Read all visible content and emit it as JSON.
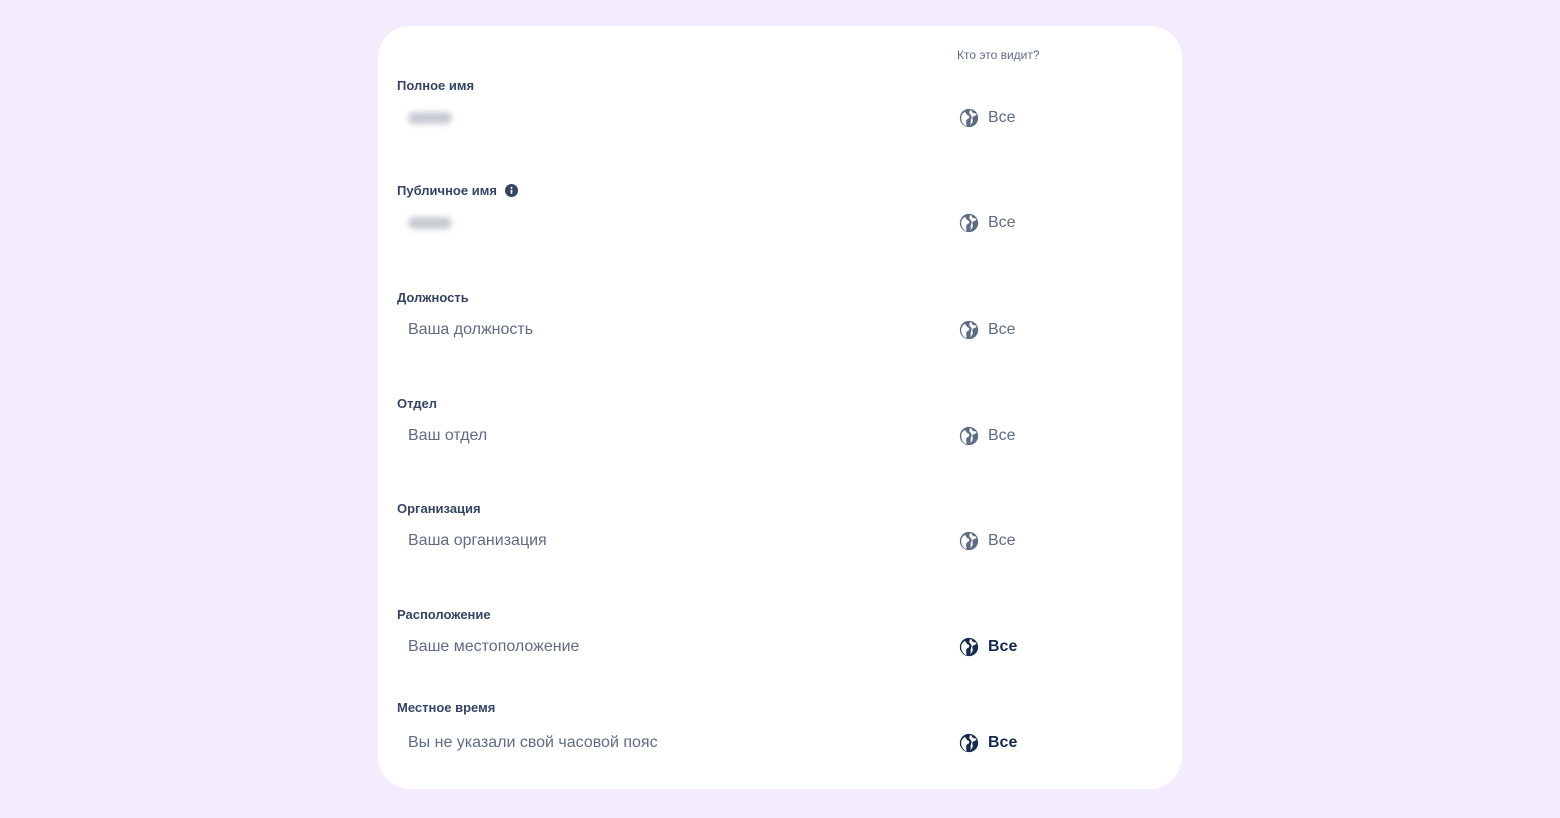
{
  "header": {
    "visibility_title": "Кто это видит?"
  },
  "fields": [
    {
      "label": "Полное имя",
      "value": "",
      "placeholder": "",
      "blurred": true,
      "visibility": "Все",
      "icon": "globe-icon"
    },
    {
      "label": "Публичное имя",
      "value": "",
      "placeholder": "",
      "blurred": true,
      "visibility": "Все",
      "icon": "globe-icon",
      "label_icon": "info-icon"
    },
    {
      "label": "Должность",
      "value": "",
      "placeholder": "Ваша должность",
      "visibility": "Все",
      "icon": "globe-icon"
    },
    {
      "label": "Отдел",
      "value": "",
      "placeholder": "Ваш отдел",
      "visibility": "Все",
      "icon": "globe-icon"
    },
    {
      "label": "Организация",
      "value": "",
      "placeholder": "Ваша организация",
      "visibility": "Все",
      "icon": "globe-icon"
    },
    {
      "label": "Расположение",
      "value": "",
      "placeholder": "Ваше местоположение",
      "visibility": "Все",
      "icon": "globe-icon"
    },
    {
      "label": "Местное время",
      "value": "",
      "placeholder": "Вы не указали свой часовой пояс",
      "visibility": "Все",
      "icon": "globe-icon"
    }
  ],
  "colors": {
    "background": "#f4ebfd",
    "card": "#ffffff",
    "label": "#344563",
    "muted": "#5e6c84",
    "dark": "#172b4d"
  }
}
